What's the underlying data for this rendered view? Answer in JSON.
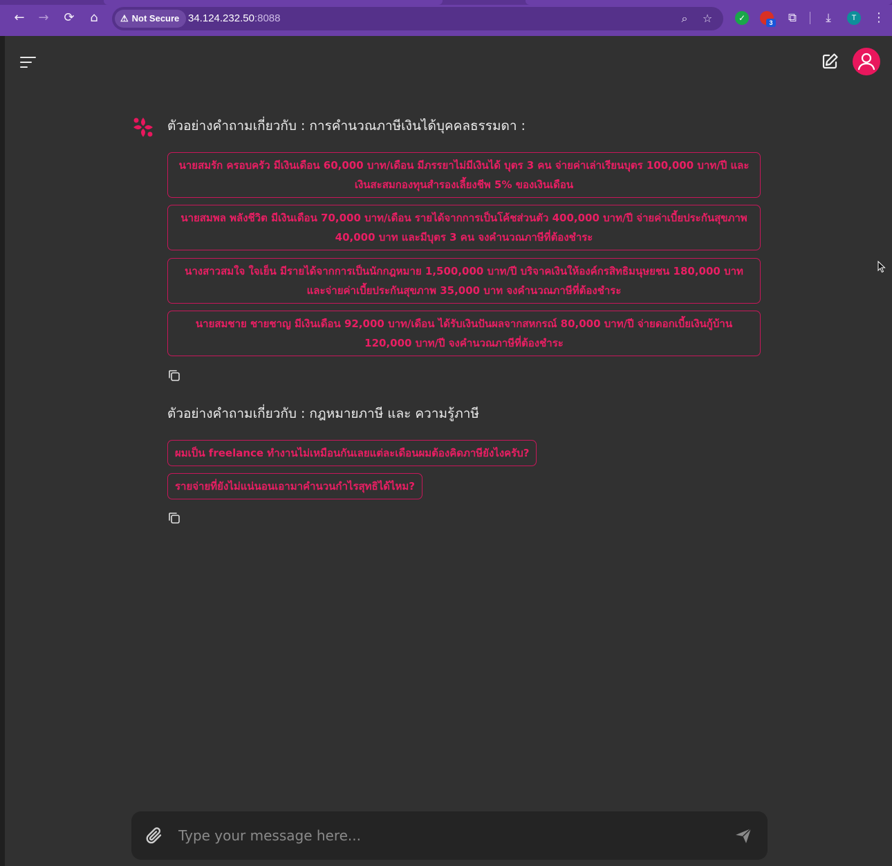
{
  "browser": {
    "security_label": "Not Secure",
    "url_host": "34.124.232.50",
    "url_port": ":8088",
    "extension_badge": "3",
    "profile_initial": "T"
  },
  "chat": {
    "section1": {
      "title": "ตัวอย่างคำถามเกี่ยวกับ : การคำนวณภาษีเงินได้บุคคลธรรมดา :",
      "suggestions": [
        "นายสมรัก ครอบครัว มีเงินเดือน 60,000 บาท/เดือน มีภรรยาไม่มีเงินได้ บุตร 3 คน จ่ายค่าเล่าเรียนบุตร 100,000 บาท/ปี และเงินสะสมกองทุนสำรองเลี้ยงชีพ 5% ของเงินเดือน",
        "นายสมพล พลังชีวิต มีเงินเดือน 70,000 บาท/เดือน รายได้จากการเป็นโค้ชส่วนตัว 400,000 บาท/ปี จ่ายค่าเบี้ยประกันสุขภาพ 40,000 บาท และมีบุตร 3 คน จงคำนวณภาษีที่ต้องชำระ",
        "นางสาวสมใจ ใจเย็น มีรายได้จากการเป็นนักกฎหมาย 1,500,000 บาท/ปี บริจาคเงินให้องค์กรสิทธิมนุษยชน 180,000 บาท และจ่ายค่าเบี้ยประกันสุขภาพ 35,000 บาท จงคำนวณภาษีที่ต้องชำระ",
        "นายสมชาย ชายชาญ มีเงินเดือน 92,000 บาท/เดือน ได้รับเงินปันผลจากสหกรณ์ 80,000 บาท/ปี จ่ายดอกเบี้ยเงินกู้บ้าน 120,000 บาท/ปี จงคำนวณภาษีที่ต้องชำระ"
      ]
    },
    "section2": {
      "title": "ตัวอย่างคำถามเกี่ยวกับ : กฎหมายภาษี และ ความรู้ภาษี",
      "suggestions": [
        "ผมเป็น freelance ทำงานไม่เหมือนกันเลยแต่ละเดือนผมต้องคิดภาษียังไงครับ?",
        "รายจ่ายที่ยังไม่แน่นอนเอามาคำนวนกำไรสุทธิได้ไหม?"
      ]
    }
  },
  "composer": {
    "placeholder": "Type your message here..."
  },
  "colors": {
    "accent": "#e91e63",
    "background": "#313131",
    "browser_chrome": "#6b3fa8"
  }
}
